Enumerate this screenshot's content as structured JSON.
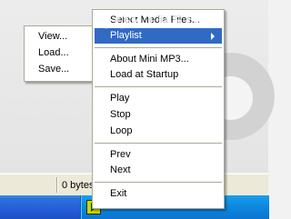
{
  "watermark": "SOFTPEDIA",
  "statusbar": {
    "size_text": "0 bytes"
  },
  "context_menu": {
    "items": [
      {
        "label": "Select Media Files..."
      },
      {
        "label": "Playlist"
      },
      {
        "label": "About Mini MP3..."
      },
      {
        "label": "Load at Startup"
      },
      {
        "label": "Play"
      },
      {
        "label": "Stop"
      },
      {
        "label": "Loop"
      },
      {
        "label": "Prev"
      },
      {
        "label": "Next"
      },
      {
        "label": "Exit"
      }
    ]
  },
  "playlist_submenu": {
    "items": [
      {
        "label": "View..."
      },
      {
        "label": "Load..."
      },
      {
        "label": "Save..."
      }
    ]
  },
  "tray": {
    "icon": "play-icon"
  },
  "colors": {
    "highlight": "#316ac5",
    "taskbar": "#245edb",
    "tray": "#0f8ae0"
  }
}
